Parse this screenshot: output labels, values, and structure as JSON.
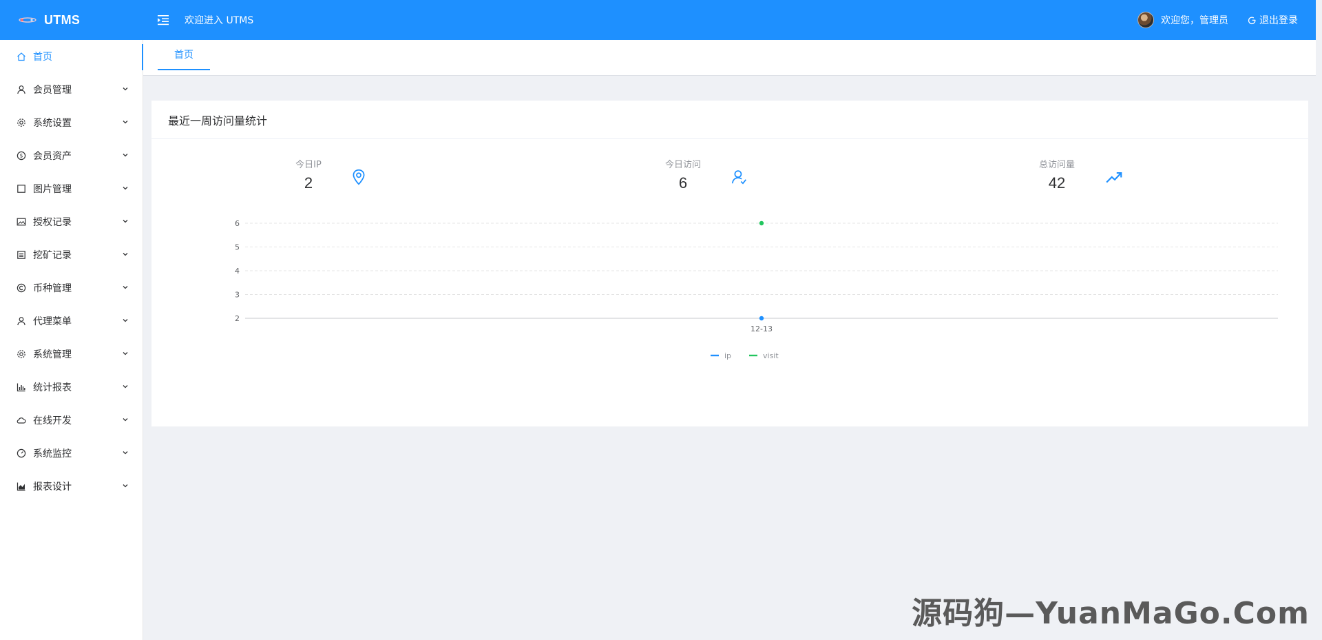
{
  "header": {
    "brand": "UTMS",
    "welcome": "欢迎进入 UTMS",
    "user_greeting": "欢迎您，管理员",
    "logout": "退出登录"
  },
  "sidebar": {
    "items": [
      {
        "label": "首页",
        "icon": "home-icon",
        "active": true
      },
      {
        "label": "会员管理",
        "icon": "user-icon"
      },
      {
        "label": "系统设置",
        "icon": "gear-icon"
      },
      {
        "label": "会员资产",
        "icon": "coin-icon"
      },
      {
        "label": "图片管理",
        "icon": "square-icon"
      },
      {
        "label": "授权记录",
        "icon": "picture-icon"
      },
      {
        "label": "挖矿记录",
        "icon": "list-icon"
      },
      {
        "label": "币种管理",
        "icon": "copyright-icon"
      },
      {
        "label": "代理菜单",
        "icon": "user-icon"
      },
      {
        "label": "系统管理",
        "icon": "gear-icon"
      },
      {
        "label": "统计报表",
        "icon": "bar-chart-icon"
      },
      {
        "label": "在线开发",
        "icon": "cloud-icon"
      },
      {
        "label": "系统监控",
        "icon": "speedometer-icon"
      },
      {
        "label": "报表设计",
        "icon": "area-chart-icon"
      }
    ]
  },
  "tabs": [
    {
      "label": "首页"
    }
  ],
  "card": {
    "title": "最近一周访问量统计",
    "stats": [
      {
        "label": "今日IP",
        "value": "2",
        "icon": "location-icon"
      },
      {
        "label": "今日访问",
        "value": "6",
        "icon": "users-icon"
      },
      {
        "label": "总访问量",
        "value": "42",
        "icon": "trend-up-icon"
      }
    ]
  },
  "chart_data": {
    "type": "scatter",
    "x": [
      "12-13"
    ],
    "series": [
      {
        "name": "ip",
        "values": [
          2
        ],
        "color": "#1e90ff"
      },
      {
        "name": "visit",
        "values": [
          6
        ],
        "color": "#22c55e"
      }
    ],
    "yticks": [
      2,
      3,
      4,
      5,
      6
    ],
    "ylim": [
      2,
      6
    ],
    "grid": true,
    "legend": "bottom-center"
  },
  "watermark": "源码狗—YuanMaGo.Com",
  "colors": {
    "primary": "#1e90ff",
    "visit": "#22c55e"
  }
}
